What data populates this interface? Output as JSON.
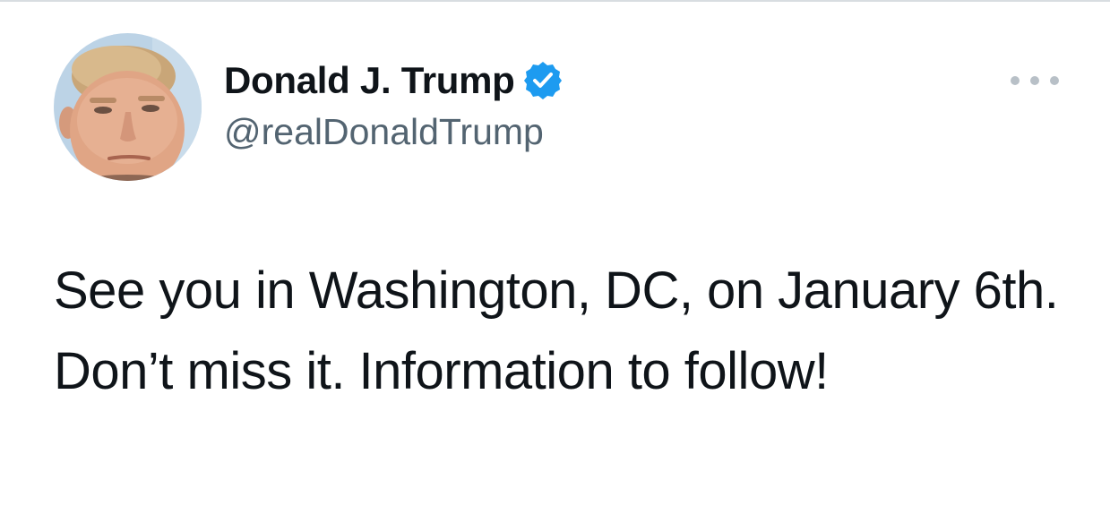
{
  "tweet": {
    "author": {
      "display_name": "Donald J. Trump",
      "handle": "@realDonaldTrump",
      "verified": true,
      "avatar_icon": "profile-photo"
    },
    "more_icon": "more-horizontal-icon",
    "text": "See you in Washington, DC, on January 6th. Don’t miss it. Information to follow!"
  },
  "colors": {
    "verified_badge": "#1d9bf0",
    "text_primary": "#0f1419",
    "text_secondary": "#536471",
    "divider": "#d8dde1"
  }
}
